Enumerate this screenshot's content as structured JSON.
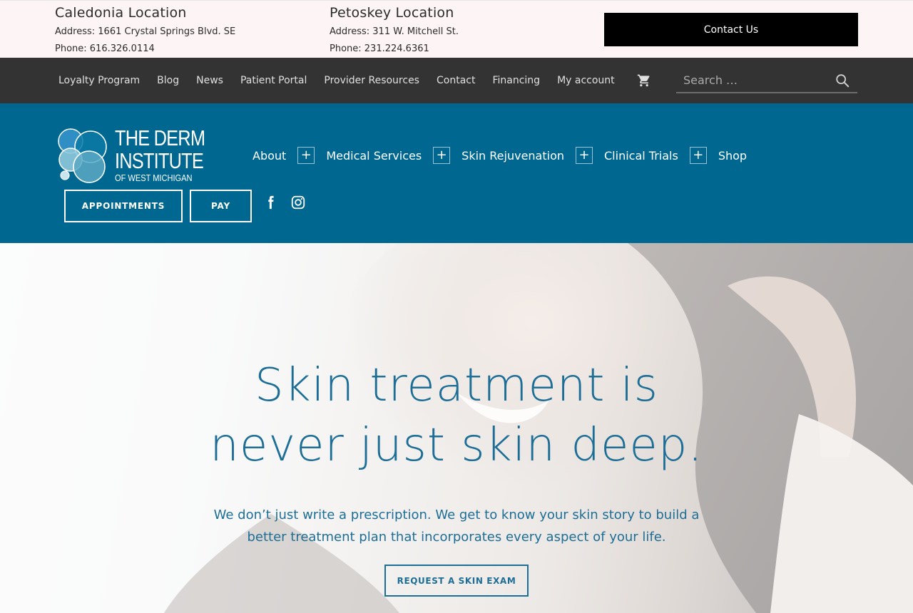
{
  "locations": [
    {
      "title": "Caledonia Location",
      "address": "Address: 1661 Crystal Springs Blvd. SE",
      "phone": "Phone: 616.326.0114"
    },
    {
      "title": "Petoskey Location",
      "address": "Address: 311 W. Mitchell St.",
      "phone": "Phone: 231.224.6361"
    }
  ],
  "contact_button": "Contact Us",
  "utility_nav": [
    "Loyalty Program",
    "Blog",
    "News",
    "Patient Portal",
    "Provider Resources",
    "Contact",
    "Financing",
    "My account"
  ],
  "search": {
    "placeholder": "Search …"
  },
  "logo": {
    "line1": "THE DERM",
    "line2": "INSTITUTE",
    "line3": "OF WEST MICHIGAN"
  },
  "main_nav": [
    "About",
    "Medical Services",
    "Skin Rejuvenation",
    "Clinical Trials",
    "Shop"
  ],
  "header_buttons": {
    "appointments": "APPOINTMENTS",
    "pay": "PAY"
  },
  "hero": {
    "headline_line1": "Skin treatment is",
    "headline_line2": "never just skin deep.",
    "body": "We don’t just write a prescription. We get to know your skin story to build a better treatment plan that incorporates every aspect of your life.",
    "cta": "REQUEST A SKIN EXAM"
  },
  "colors": {
    "header_blue": "#006890",
    "utility_dark": "#333333",
    "hero_text": "#1d6e96",
    "locbar_bg": "#fdf5f5"
  }
}
